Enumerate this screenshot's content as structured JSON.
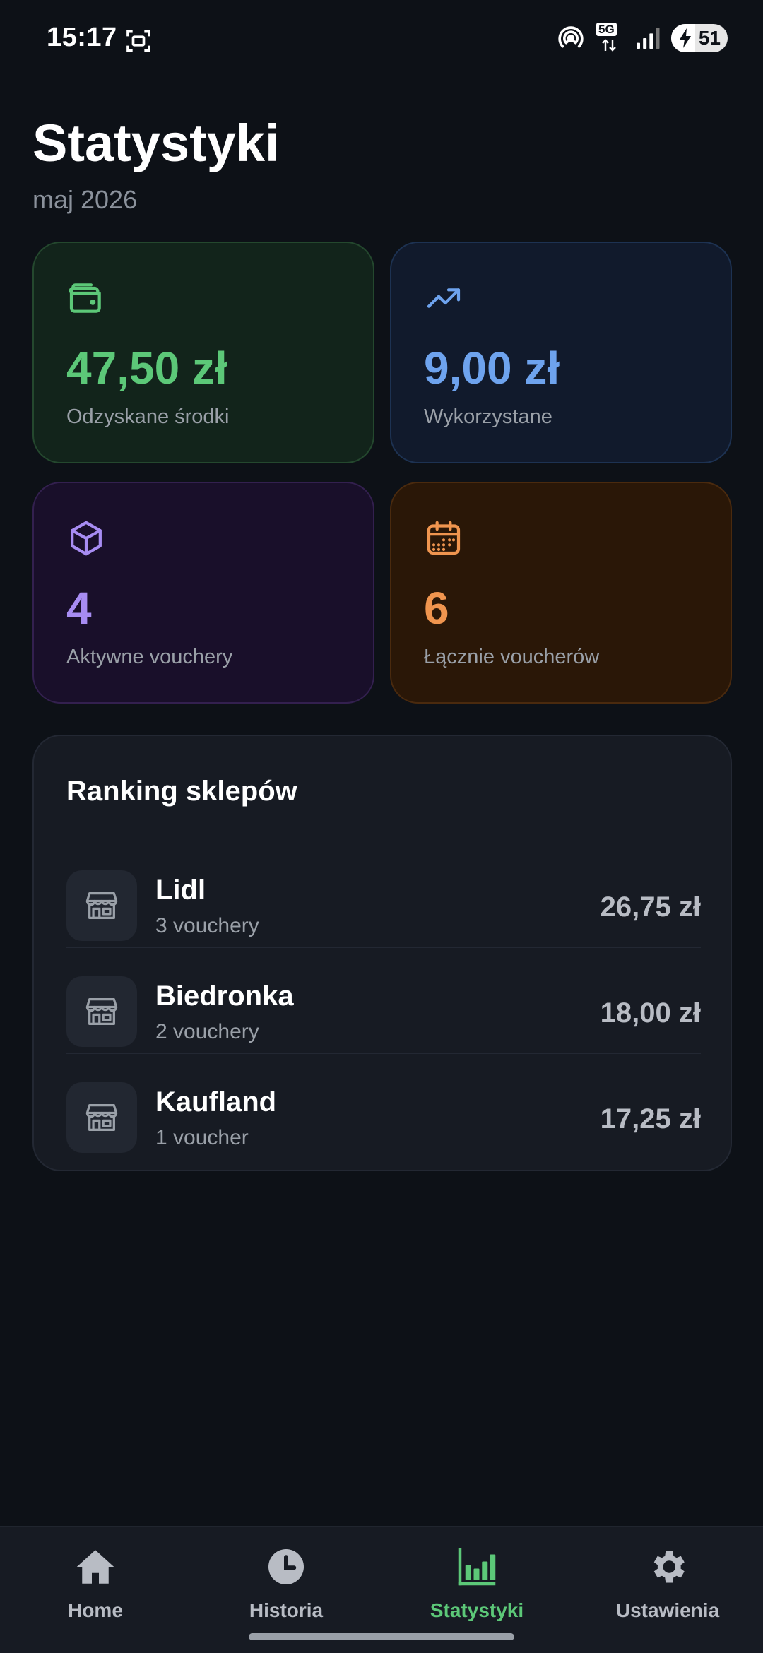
{
  "status_bar": {
    "time": "15:17",
    "network": "5G",
    "battery_level": "51",
    "icons": [
      "screenshot-icon",
      "hotspot-icon",
      "5g-icon",
      "signal-icon",
      "battery-charging-icon"
    ]
  },
  "header": {
    "title": "Statystyki",
    "subtitle": "maj 2026"
  },
  "stats": {
    "recovered": {
      "value": "47,50 zł",
      "label": "Odzyskane środki",
      "icon": "wallet-icon",
      "color": "#5cc878"
    },
    "used": {
      "value": "9,00 zł",
      "label": "Wykorzystane",
      "icon": "trending-up-icon",
      "color": "#6ea3ee"
    },
    "active": {
      "value": "4",
      "label": "Aktywne vouchery",
      "icon": "box-icon",
      "color": "#a78cf2"
    },
    "total": {
      "value": "6",
      "label": "Łącznie voucherów",
      "icon": "calendar-icon",
      "color": "#f0954f"
    }
  },
  "ranking": {
    "title": "Ranking sklepów",
    "stores": [
      {
        "name": "Lidl",
        "count": "3 vouchery",
        "amount": "26,75 zł"
      },
      {
        "name": "Biedronka",
        "count": "2 vouchery",
        "amount": "18,00 zł"
      },
      {
        "name": "Kaufland",
        "count": "1 voucher",
        "amount": "17,25 zł"
      }
    ]
  },
  "nav": {
    "home": {
      "label": "Home",
      "icon": "home-icon"
    },
    "history": {
      "label": "Historia",
      "icon": "clock-icon"
    },
    "stats": {
      "label": "Statystyki",
      "icon": "bar-chart-icon",
      "active": true
    },
    "settings": {
      "label": "Ustawienia",
      "icon": "gear-icon"
    }
  },
  "colors": {
    "background": "#0d1117",
    "accent": "#5cc878"
  }
}
